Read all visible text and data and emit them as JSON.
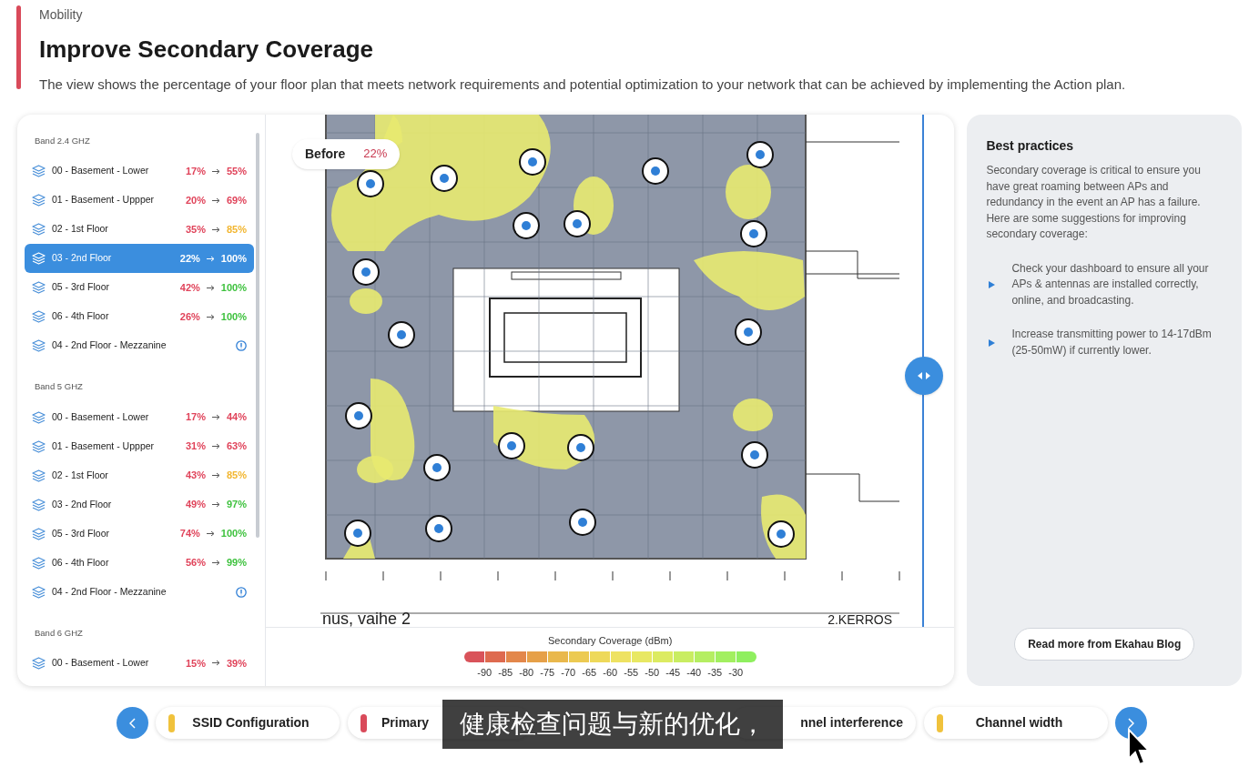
{
  "header": {
    "eyebrow": "Mobility",
    "title": "Improve Secondary Coverage",
    "description": "The view shows the percentage of your floor plan that meets network requirements and potential optimization to your network that can be achieved by implementing the Action plan."
  },
  "floor_list": {
    "groups": [
      {
        "label": "Band 2.4 GHZ",
        "items": [
          {
            "name": "00 - Basement - Lower",
            "kind": "result",
            "selected": false,
            "values": [
              {
                "text": "17%",
                "color": "#e0435a"
              },
              {
                "text": "55%",
                "color": "#e0435a"
              }
            ]
          },
          {
            "name": "01 - Basement - Uppper",
            "kind": "result",
            "selected": false,
            "values": [
              {
                "text": "20%",
                "color": "#e0435a"
              },
              {
                "text": "69%",
                "color": "#e0435a"
              }
            ]
          },
          {
            "name": "02 - 1st Floor",
            "kind": "result",
            "selected": false,
            "values": [
              {
                "text": "35%",
                "color": "#e0435a"
              },
              {
                "text": "85%",
                "color": "#f2b630"
              }
            ]
          },
          {
            "name": "03 - 2nd Floor",
            "kind": "result",
            "selected": true,
            "values": [
              {
                "text": "22%"
              },
              {
                "text": "100%"
              }
            ]
          },
          {
            "name": "05 - 3rd Floor",
            "kind": "result",
            "selected": false,
            "values": [
              {
                "text": "42%",
                "color": "#e0435a"
              },
              {
                "text": "100%",
                "color": "#3fc23f"
              }
            ]
          },
          {
            "name": "06 - 4th Floor",
            "kind": "result",
            "selected": false,
            "values": [
              {
                "text": "26%",
                "color": "#e0435a"
              },
              {
                "text": "100%",
                "color": "#3fc23f"
              }
            ]
          },
          {
            "name": "04 - 2nd Floor - Mezzanine",
            "kind": "info",
            "selected": false
          }
        ]
      },
      {
        "label": "Band 5 GHZ",
        "items": [
          {
            "name": "00 - Basement - Lower",
            "kind": "result",
            "selected": false,
            "values": [
              {
                "text": "17%",
                "color": "#e0435a"
              },
              {
                "text": "44%",
                "color": "#e0435a"
              }
            ]
          },
          {
            "name": "01 - Basement - Uppper",
            "kind": "result",
            "selected": false,
            "values": [
              {
                "text": "31%",
                "color": "#e0435a"
              },
              {
                "text": "63%",
                "color": "#e0435a"
              }
            ]
          },
          {
            "name": "02 - 1st Floor",
            "kind": "result",
            "selected": false,
            "values": [
              {
                "text": "43%",
                "color": "#e0435a"
              },
              {
                "text": "85%",
                "color": "#f2b630"
              }
            ]
          },
          {
            "name": "03 - 2nd Floor",
            "kind": "result",
            "selected": false,
            "values": [
              {
                "text": "49%",
                "color": "#e0435a"
              },
              {
                "text": "97%",
                "color": "#3fc23f"
              }
            ]
          },
          {
            "name": "05 - 3rd Floor",
            "kind": "result",
            "selected": false,
            "values": [
              {
                "text": "74%",
                "color": "#e0435a"
              },
              {
                "text": "100%",
                "color": "#3fc23f"
              }
            ]
          },
          {
            "name": "06 - 4th Floor",
            "kind": "result",
            "selected": false,
            "values": [
              {
                "text": "56%",
                "color": "#e0435a"
              },
              {
                "text": "99%",
                "color": "#3fc23f"
              }
            ]
          },
          {
            "name": "04 - 2nd Floor - Mezzanine",
            "kind": "info",
            "selected": false
          }
        ]
      },
      {
        "label": "Band 6 GHZ",
        "items": [
          {
            "name": "00 - Basement - Lower",
            "kind": "result",
            "selected": false,
            "values": [
              {
                "text": "15%",
                "color": "#e0435a"
              },
              {
                "text": "39%",
                "color": "#e0435a"
              }
            ]
          }
        ]
      }
    ]
  },
  "map": {
    "before_badge": {
      "label": "Before",
      "value": "22%"
    },
    "plan_texts": [
      "nus, vaihe 2",
      "2.KERROS"
    ],
    "legend": {
      "title": "Secondary Coverage (dBm)",
      "swatches": [
        {
          "color": "#d9535a"
        },
        {
          "color": "#de6a4f"
        },
        {
          "color": "#e3874a"
        },
        {
          "color": "#e6a048"
        },
        {
          "color": "#e9b84c"
        },
        {
          "color": "#ecca52"
        },
        {
          "color": "#eed95a"
        },
        {
          "color": "#eee262"
        },
        {
          "color": "#e8e863"
        },
        {
          "color": "#dceb62"
        },
        {
          "color": "#c9ed62"
        },
        {
          "color": "#b5ee62"
        },
        {
          "color": "#a2ef60"
        },
        {
          "color": "#8fef5f"
        }
      ],
      "labels": [
        "-90",
        "-85",
        "-80",
        "-75",
        "-70",
        "-65",
        "-60",
        "-55",
        "-50",
        "-45",
        "-40",
        "-35",
        "-30"
      ]
    }
  },
  "best_practices": {
    "title": "Best practices",
    "intro": "Secondary coverage is critical to ensure you have great roaming between APs and redundancy in the event an AP has a failure. Here are some suggestions for improving secondary coverage:",
    "tips": [
      "Check your dashboard to ensure all your APs & antennas are installed correctly, online, and broadcasting.",
      "Increase transmitting power to 14-17dBm (25-50mW) if currently lower."
    ],
    "button": "Read more from Ekahau Blog"
  },
  "issue_tabs": [
    {
      "label": "SSID Configuration",
      "kind": "tab",
      "selected": false,
      "color": "#f0c23c"
    },
    {
      "label": "Primary",
      "kind": "tab",
      "selected": false,
      "color": "#d94a5a"
    },
    {
      "kind": "hidden"
    },
    {
      "label": "nnel interference",
      "kind": "tab",
      "selected": false
    },
    {
      "label": "Channel width",
      "kind": "tab",
      "selected": false,
      "color": "#f0c23c"
    }
  ],
  "subtitle": "健康检查问题与新的优化，"
}
